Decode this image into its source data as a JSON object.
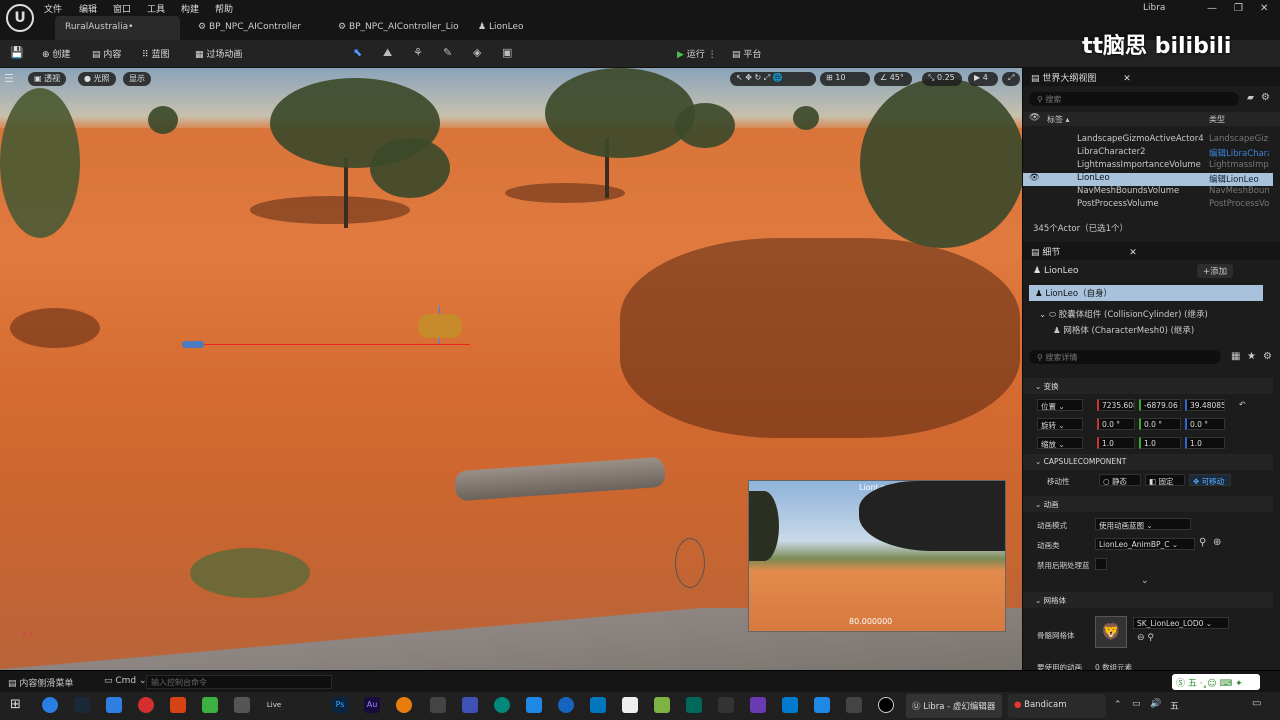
{
  "window": {
    "app_title": "Libra",
    "menus": [
      "文件",
      "编辑",
      "窗口",
      "工具",
      "构建",
      "帮助"
    ],
    "tabs": [
      "RuralAustralia•",
      "BP_NPC_AIController",
      "BP_NPC_AIController_Lio",
      "LionLeo"
    ]
  },
  "toolbar": {
    "create": "创建",
    "content": "内容",
    "blueprint": "蓝图",
    "cinematics": "过场动画",
    "play": "运行",
    "platform": "平台"
  },
  "viewport": {
    "perspective": "透视",
    "lit": "光照",
    "show": "显示",
    "grid": "10",
    "angle": "45°",
    "scale": "0.25",
    "cam": "4",
    "pip_title": "LionLeo",
    "pip_value": "80.000000"
  },
  "outliner": {
    "title": "世界大纲视图",
    "search_placeholder": "搜索",
    "col_label": "标签 ▴",
    "col_type": "类型",
    "rows": [
      {
        "name": "LandscapeGizmoActiveActor4",
        "type": "LandscapeGizn"
      },
      {
        "name": "LibraCharacter2",
        "type": "编辑LibraChara"
      },
      {
        "name": "LightmassImportanceVolume",
        "type": "LightmassImpo"
      },
      {
        "name": "LionLeo",
        "type": "编辑LionLeo"
      },
      {
        "name": "NavMeshBoundsVolume",
        "type": "NavMeshBoun"
      },
      {
        "name": "PostProcessVolume",
        "type": "PostProcessVo"
      }
    ],
    "count": "345个Actor（已选1个）"
  },
  "details": {
    "title": "细节",
    "actor": "LionLeo",
    "add": "+添加",
    "self": "LionLeo（自身）",
    "comp1": "胶囊体组件 (CollisionCylinder) (继承)",
    "comp2": "网格体 (CharacterMesh0) (继承)",
    "search_placeholder": "搜索详情",
    "transform": "变换",
    "loc_label": "位置",
    "loc": [
      "7235.608",
      "-6879.06",
      "39.48085"
    ],
    "rot_label": "旋转",
    "rot": [
      "0.0 °",
      "0.0 °",
      "0.0 °"
    ],
    "scale_label": "缩放",
    "scale": [
      "1.0",
      "1.0",
      "1.0"
    ],
    "capsule": "CAPSULECOMPONENT",
    "mobility": "移动性",
    "static": "静态",
    "fixed": "固定",
    "movable": "可移动",
    "anim": "动画",
    "anim_mode_label": "动画模式",
    "anim_mode": "使用动画蓝图",
    "anim_class_label": "动画类",
    "anim_class": "LionLeo_AnimBP_C",
    "disable_post": "禁用后期处理蓝",
    "mesh": "网格体",
    "skel_label": "骨骼网格体",
    "skel": "SK_LionLeo_LOD0",
    "extra_label": "要使用的动画",
    "extra_val": "0 数组元素"
  },
  "status": {
    "content_drawer": "内容侧滑菜单",
    "cmd": "Cmd",
    "console_placeholder": "输入控制台命令"
  },
  "taskbar": {
    "libra": "Libra - 虚幻编辑器",
    "bandicam": "Bandicam",
    "ime": "五"
  },
  "watermark": "tt脑思 bilibili"
}
